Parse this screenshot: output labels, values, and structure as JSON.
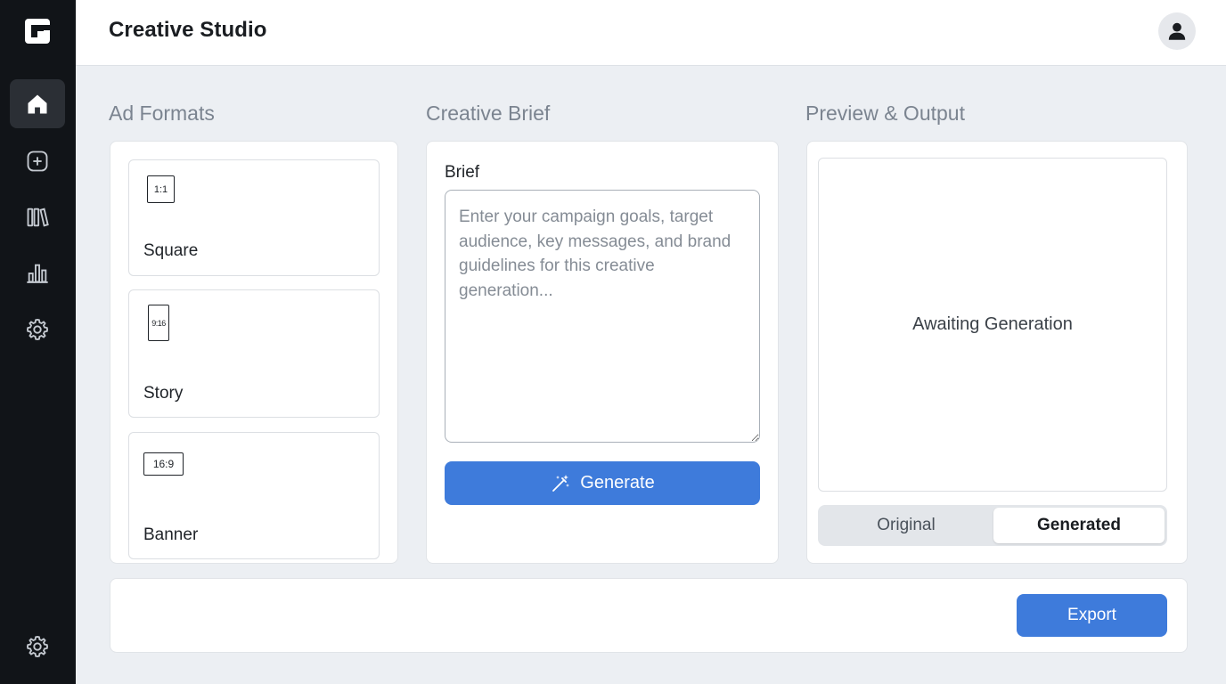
{
  "app": {
    "title": "Creative Studio"
  },
  "sidebar": {
    "items": [
      {
        "name": "home",
        "icon": "home-icon",
        "active": true
      },
      {
        "name": "create",
        "icon": "plus-circle-icon",
        "active": false
      },
      {
        "name": "library",
        "icon": "library-icon",
        "active": false
      },
      {
        "name": "analytics",
        "icon": "bar-chart-icon",
        "active": false
      },
      {
        "name": "settings",
        "icon": "gear-icon",
        "active": false
      }
    ],
    "bottom_item": {
      "name": "settings",
      "icon": "gear-icon"
    }
  },
  "sections": {
    "formats_title": "Ad Formats",
    "brief_title": "Creative Brief",
    "preview_title": "Preview & Output"
  },
  "formats": [
    {
      "label": "Square",
      "ratio": "1:1"
    },
    {
      "label": "Story",
      "ratio": "9:16"
    },
    {
      "label": "Banner",
      "ratio": "16:9"
    }
  ],
  "brief": {
    "label": "Brief",
    "value": "",
    "placeholder": "Enter your campaign goals, target audience, key messages, and brand guidelines for this creative generation...",
    "generate_label": "Generate"
  },
  "preview": {
    "status_text": "Awaiting Generation",
    "toggle": {
      "original_label": "Original",
      "generated_label": "Generated",
      "selected": "Generated"
    }
  },
  "footer": {
    "export_label": "Export"
  },
  "colors": {
    "accent": "#3e7bdb",
    "sidebar_bg": "#111418",
    "page_bg": "#eceff3"
  }
}
